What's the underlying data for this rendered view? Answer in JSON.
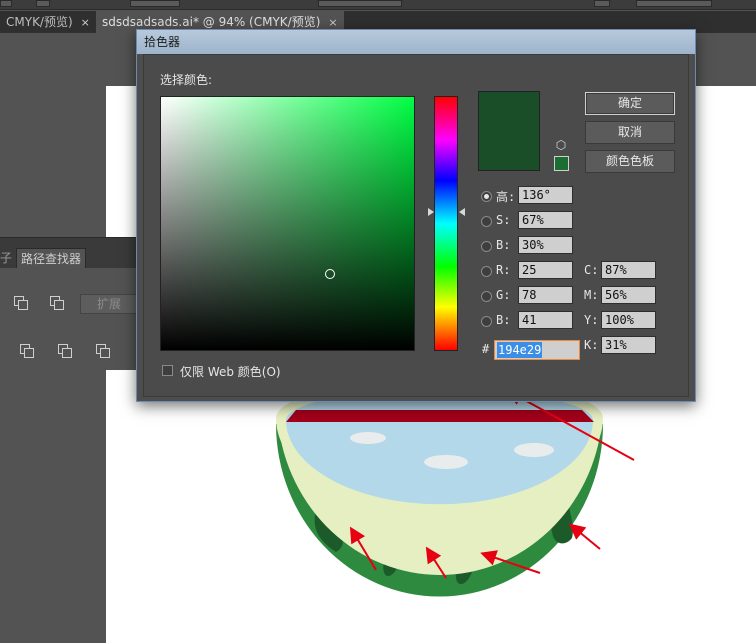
{
  "tabs": [
    {
      "label": "CMYK/预览)",
      "close": "×"
    },
    {
      "label": "sdsdsadsads.ai* @ 94% (CMYK/预览)",
      "close": "×"
    }
  ],
  "pathfinder": {
    "tab_cut_label": "子",
    "tab_label": "路径查找器",
    "expand_label": "扩展"
  },
  "dialog": {
    "title": "拾色器",
    "select_label": "选择颜色:",
    "buttons": {
      "ok": "确定",
      "cancel": "取消",
      "swatches": "颜色色板"
    },
    "fields": {
      "H": {
        "label": "高:",
        "value": "136°",
        "selected": true
      },
      "S": {
        "label": "S:",
        "value": "67%"
      },
      "B": {
        "label": "B:",
        "value": "30%"
      },
      "R": {
        "label": "R:",
        "value": "25"
      },
      "G": {
        "label": "G:",
        "value": "78"
      },
      "Bl": {
        "label": "B:",
        "value": "41"
      },
      "C": {
        "label": "C:",
        "value": "87%"
      },
      "M": {
        "label": "M:",
        "value": "56%"
      },
      "Y": {
        "label": "Y:",
        "value": "100%"
      },
      "K": {
        "label": "K:",
        "value": "31%"
      }
    },
    "hex_prefix": "#",
    "hex_value": "194e29",
    "web_only_label": "仅限 Web 颜色(O)",
    "web_only_checked": false
  },
  "colors": {
    "selected_color": "#194e29",
    "gamut_swatch": "#1a6e32",
    "melon_rind": "#2e8a3e",
    "melon_stripe": "#1c5a2a",
    "melon_flesh": "#b3d8ea",
    "melon_red": "#a3001a",
    "arrow": "#e60012"
  },
  "icons": {
    "cube": "cube-icon",
    "close": "close-icon",
    "pathfinder_shapes": [
      "unite-icon",
      "minus-front-icon",
      "divide-icon",
      "trim-icon",
      "merge-icon",
      "crop-icon"
    ]
  }
}
